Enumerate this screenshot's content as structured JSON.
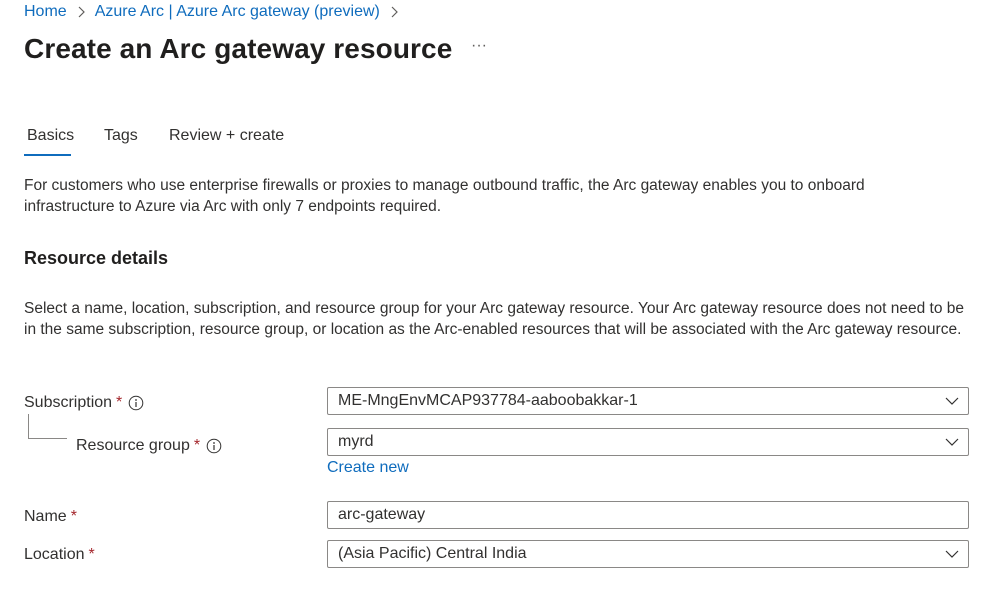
{
  "breadcrumb": {
    "items": [
      "Home",
      "Azure Arc | Azure Arc gateway (preview)"
    ]
  },
  "page": {
    "title": "Create an Arc gateway resource",
    "more_label": "···"
  },
  "tabs": [
    {
      "label": "Basics",
      "selected": true
    },
    {
      "label": "Tags",
      "selected": false
    },
    {
      "label": "Review + create",
      "selected": false
    }
  ],
  "intro": "For customers who use enterprise firewalls or proxies to manage outbound traffic, the Arc gateway enables you to onboard infrastructure to Azure via Arc with only 7 endpoints required.",
  "resource_details": {
    "heading": "Resource details",
    "description": "Select a name, location, subscription, and resource group for your Arc gateway resource. Your Arc gateway resource does not need to be in the same subscription, resource group, or location as the Arc-enabled resources that will be associated with the Arc gateway resource."
  },
  "form": {
    "required_marker": "*",
    "subscription": {
      "label": "Subscription",
      "value": "ME-MngEnvMCAP937784-aaboobakkar-1"
    },
    "resource_group": {
      "label": "Resource group",
      "value": "myrd",
      "create_new": "Create new"
    },
    "name": {
      "label": "Name",
      "value": "arc-gateway"
    },
    "location": {
      "label": "Location",
      "value": "(Asia Pacific) Central India"
    }
  },
  "colors": {
    "accent": "#0f6cbd",
    "required": "#a4262c",
    "border": "#8a8886"
  },
  "icons": {
    "breadcrumb_separator": "chevron-right-icon",
    "info": "info-icon",
    "dropdown": "chevron-down-icon"
  }
}
